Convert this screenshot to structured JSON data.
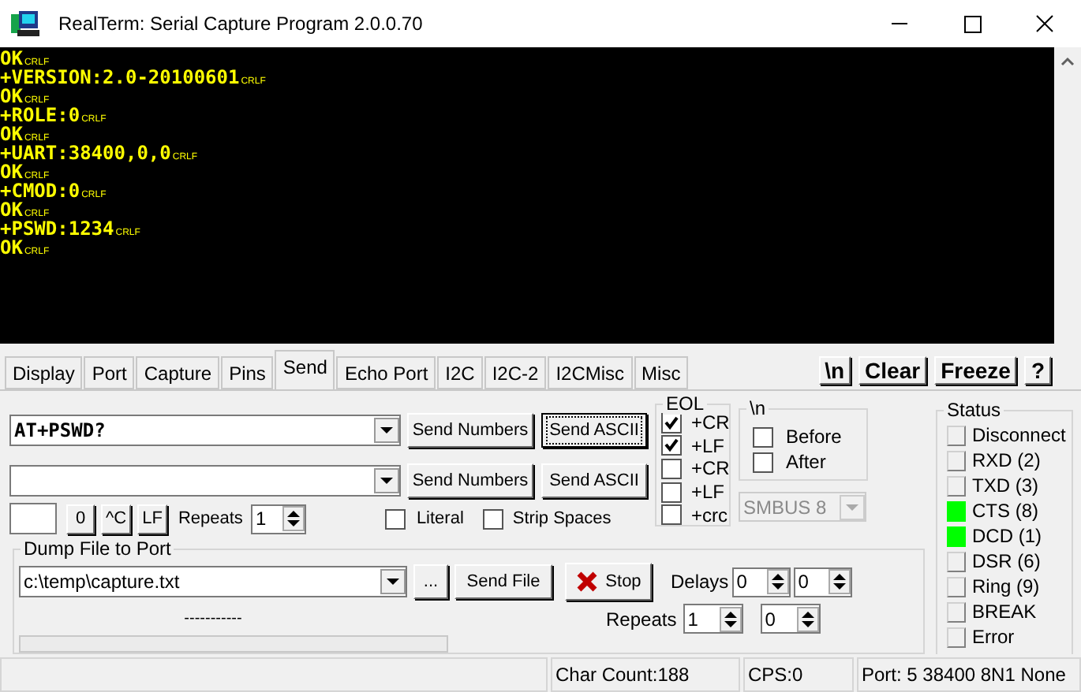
{
  "window": {
    "title": "RealTerm: Serial Capture Program 2.0.0.70"
  },
  "terminal": {
    "lines": [
      {
        "text": "OK",
        "eol": "CRLF"
      },
      {
        "text": "+VERSION:2.0-20100601",
        "eol": "CRLF"
      },
      {
        "text": "OK",
        "eol": "CRLF"
      },
      {
        "text": "+ROLE:0",
        "eol": "CRLF"
      },
      {
        "text": "OK",
        "eol": "CRLF"
      },
      {
        "text": "+UART:38400,0,0",
        "eol": "CRLF"
      },
      {
        "text": "OK",
        "eol": "CRLF"
      },
      {
        "text": "+CMOD:0",
        "eol": "CRLF"
      },
      {
        "text": "OK",
        "eol": "CRLF"
      },
      {
        "text": "+PSWD:1234",
        "eol": "CRLF"
      },
      {
        "text": "OK",
        "eol": "CRLF"
      }
    ]
  },
  "tabs": [
    {
      "label": "Display",
      "selected": false
    },
    {
      "label": "Port",
      "selected": false
    },
    {
      "label": "Capture",
      "selected": false
    },
    {
      "label": "Pins",
      "selected": false
    },
    {
      "label": "Send",
      "selected": true
    },
    {
      "label": "Echo Port",
      "selected": false
    },
    {
      "label": "I2C",
      "selected": false
    },
    {
      "label": "I2C-2",
      "selected": false
    },
    {
      "label": "I2CMisc",
      "selected": false
    },
    {
      "label": "Misc",
      "selected": false
    }
  ],
  "tool_buttons": [
    {
      "label": "\\n"
    },
    {
      "label": "Clear"
    },
    {
      "label": "Freeze"
    },
    {
      "label": "?"
    }
  ],
  "send": {
    "rows": [
      {
        "value": "AT+PSWD?",
        "numbers_button": "Send Numbers",
        "ascii_button": "Send ASCII",
        "focused": true
      },
      {
        "value": "",
        "numbers_button": "Send Numbers",
        "ascii_button": "Send ASCII",
        "focused": false
      }
    ],
    "small_buttons": [
      "0",
      "^C",
      "LF"
    ],
    "repeats_label": "Repeats",
    "repeats_value": "1",
    "literal": {
      "label": "Literal",
      "checked": false
    },
    "strip_spaces": {
      "label": "Strip Spaces",
      "checked": false
    },
    "eol": {
      "title": "EOL",
      "options": [
        {
          "label": "+CR",
          "checked": true
        },
        {
          "label": "+LF",
          "checked": true
        },
        {
          "label": "+CR",
          "checked": false
        },
        {
          "label": "+LF",
          "checked": false
        },
        {
          "label": "+crc",
          "checked": false
        }
      ]
    },
    "newline": {
      "title": "\\n",
      "options": [
        {
          "label": "Before",
          "checked": false
        },
        {
          "label": "After",
          "checked": false
        }
      ]
    },
    "smbus": {
      "value": "SMBUS 8",
      "disabled": true
    }
  },
  "dump": {
    "title": "Dump File to Port",
    "file": "c:\\temp\\capture.txt",
    "browse_button": "...",
    "send_file_button": "Send File",
    "stop_button": "Stop",
    "progress_label": "-----------",
    "progress": {
      "level": 0
    },
    "delays_label": "Delays",
    "delays": [
      "0",
      "0"
    ],
    "repeats_label": "Repeats",
    "repeats": [
      "1",
      "0"
    ]
  },
  "status": {
    "title": "Status",
    "items": [
      {
        "label": "Disconnect",
        "on": false
      },
      {
        "label": "RXD (2)",
        "on": false
      },
      {
        "label": "TXD (3)",
        "on": false
      },
      {
        "label": "CTS (8)",
        "on": true
      },
      {
        "label": "DCD (1)",
        "on": true
      },
      {
        "label": "DSR (6)",
        "on": false
      },
      {
        "label": "Ring (9)",
        "on": false
      },
      {
        "label": "BREAK",
        "on": false
      },
      {
        "label": "Error",
        "on": false
      }
    ]
  },
  "status_bar": {
    "char_count": "Char Count:188",
    "cps": "CPS:0",
    "port": "Port: 5 38400 8N1 None"
  }
}
